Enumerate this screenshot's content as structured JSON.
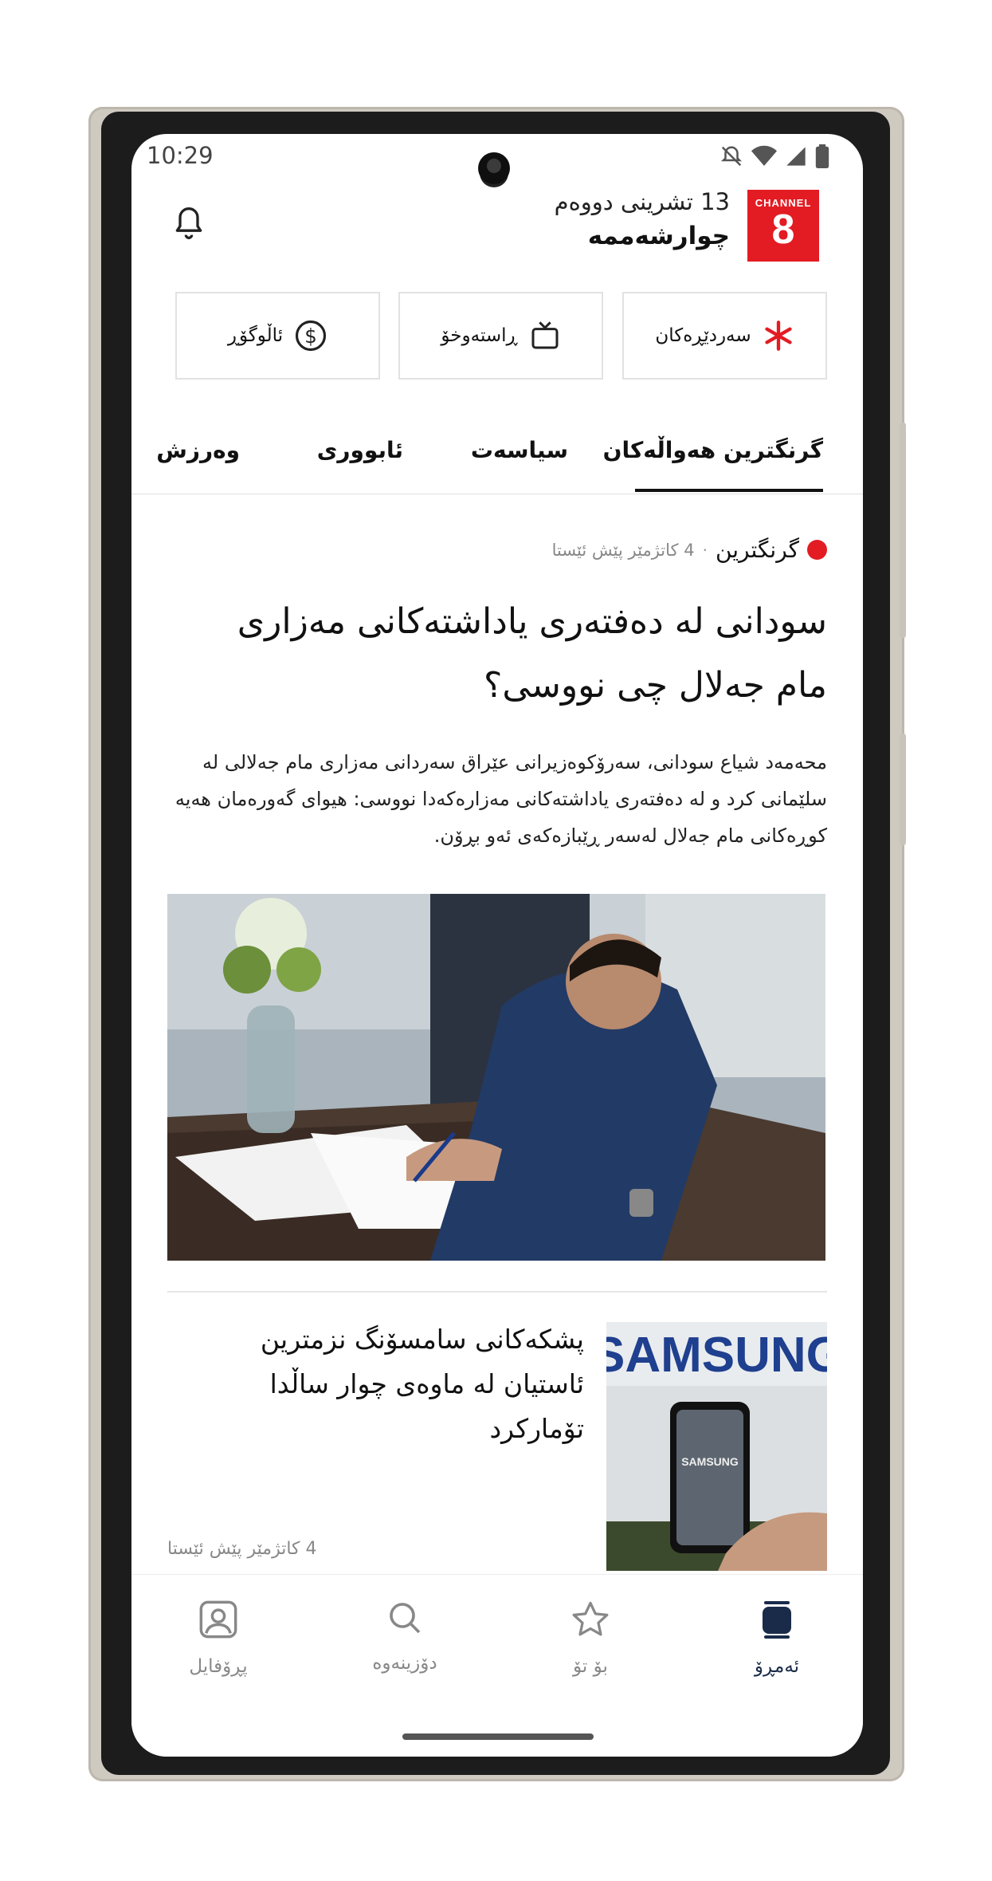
{
  "status_bar": {
    "time": "10:29"
  },
  "header": {
    "date_line1": "13 تشرینی دووەم",
    "date_line2": "چوارشەممە",
    "logo_top": "CHANNEL",
    "logo_number": "8"
  },
  "quick_buttons": [
    {
      "label": "سەردێڕەکان",
      "icon": "asterisk-icon"
    },
    {
      "label": "ڕاستەوخۆ",
      "icon": "tv-icon"
    },
    {
      "label": "ئاڵوگۆڕ",
      "icon": "dollar-circle-icon"
    }
  ],
  "tabs": [
    {
      "label": "گرنگترین هەواڵەکان",
      "active": true
    },
    {
      "label": "سیاسەت"
    },
    {
      "label": "ئابووری"
    },
    {
      "label": "وەرزش"
    }
  ],
  "main_article": {
    "category": "گرنگترین",
    "separator": "·",
    "time": "4 کاتژمێر پێش ئێستا",
    "headline": "سودانی لە دەفتەری یاداشتەکانی مەزاری مام جەلال چی نووسی؟",
    "lede": "محەمەد شیاع سودانی، سەرۆکوەزیرانی عێراق سەردانی مەزاری مام جەلالی لە سلێمانی کرد و لە دەفتەری یاداشتەکانی مەزارەکەدا نووسی: هیوای گەورەمان هەیە کوڕەکانی مام جەلال لەسەر ڕێبازەکەی ئەو بڕۆن."
  },
  "second_article": {
    "title": "پشکەکانی سامسۆنگ نزمترین ئاستیان لە ماوەی چوار ساڵدا تۆمارکرد",
    "time": "4 کاتژمێر پێش ئێستا",
    "thumb_text": "SAMSUNG",
    "thumb_phone_text": "SAMSUNG"
  },
  "bottom_nav": [
    {
      "label": "پڕۆفایل",
      "icon": "profile-icon"
    },
    {
      "label": "دۆزینەوە",
      "icon": "search-icon"
    },
    {
      "label": "بۆ تۆ",
      "icon": "star-icon"
    },
    {
      "label": "ئەمڕۆ",
      "icon": "today-icon",
      "active": true
    }
  ],
  "colors": {
    "brand_red": "#e31b23",
    "active_nav": "#1a2b4a"
  }
}
